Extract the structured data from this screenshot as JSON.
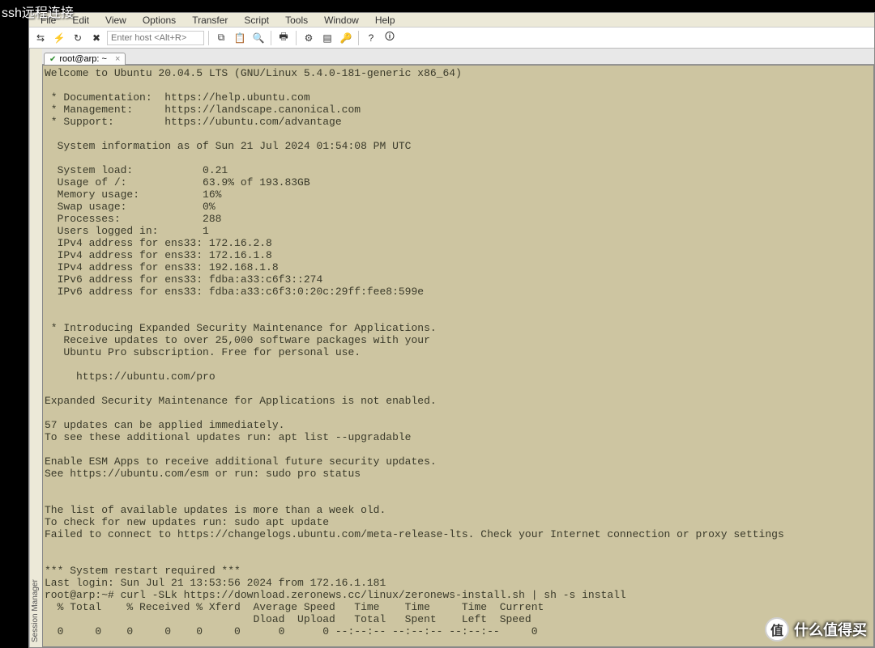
{
  "overlay_title": "ssh远程连接",
  "menu": [
    "File",
    "Edit",
    "View",
    "Options",
    "Transfer",
    "Script",
    "Tools",
    "Window",
    "Help"
  ],
  "toolbar": {
    "host_placeholder": "Enter host <Alt+R>"
  },
  "session_manager_label": "Session Manager",
  "tab": {
    "title": "root@arp: ~",
    "close": "×"
  },
  "terminal_text": "Welcome to Ubuntu 20.04.5 LTS (GNU/Linux 5.4.0-181-generic x86_64)\n\n * Documentation:  https://help.ubuntu.com\n * Management:     https://landscape.canonical.com\n * Support:        https://ubuntu.com/advantage\n\n  System information as of Sun 21 Jul 2024 01:54:08 PM UTC\n\n  System load:           0.21\n  Usage of /:            63.9% of 193.83GB\n  Memory usage:          16%\n  Swap usage:            0%\n  Processes:             288\n  Users logged in:       1\n  IPv4 address for ens33: 172.16.2.8\n  IPv4 address for ens33: 172.16.1.8\n  IPv4 address for ens33: 192.168.1.8\n  IPv6 address for ens33: fdba:a33:c6f3::274\n  IPv6 address for ens33: fdba:a33:c6f3:0:20c:29ff:fee8:599e\n\n\n * Introducing Expanded Security Maintenance for Applications.\n   Receive updates to over 25,000 software packages with your\n   Ubuntu Pro subscription. Free for personal use.\n\n     https://ubuntu.com/pro\n\nExpanded Security Maintenance for Applications is not enabled.\n\n57 updates can be applied immediately.\nTo see these additional updates run: apt list --upgradable\n\nEnable ESM Apps to receive additional future security updates.\nSee https://ubuntu.com/esm or run: sudo pro status\n\n\nThe list of available updates is more than a week old.\nTo check for new updates run: sudo apt update\nFailed to connect to https://changelogs.ubuntu.com/meta-release-lts. Check your Internet connection or proxy settings\n\n\n*** System restart required ***\nLast login: Sun Jul 21 13:53:56 2024 from 172.16.1.181\nroot@arp:~# curl -SLk https://download.zeronews.cc/linux/zeronews-install.sh | sh -s install\n  % Total    % Received % Xferd  Average Speed   Time    Time     Time  Current\n                                 Dload  Upload   Total   Spent    Left  Speed\n  0     0    0     0    0     0      0      0 --:--:-- --:--:-- --:--:--     0",
  "watermark": {
    "badge": "值",
    "text": "什么值得买"
  }
}
